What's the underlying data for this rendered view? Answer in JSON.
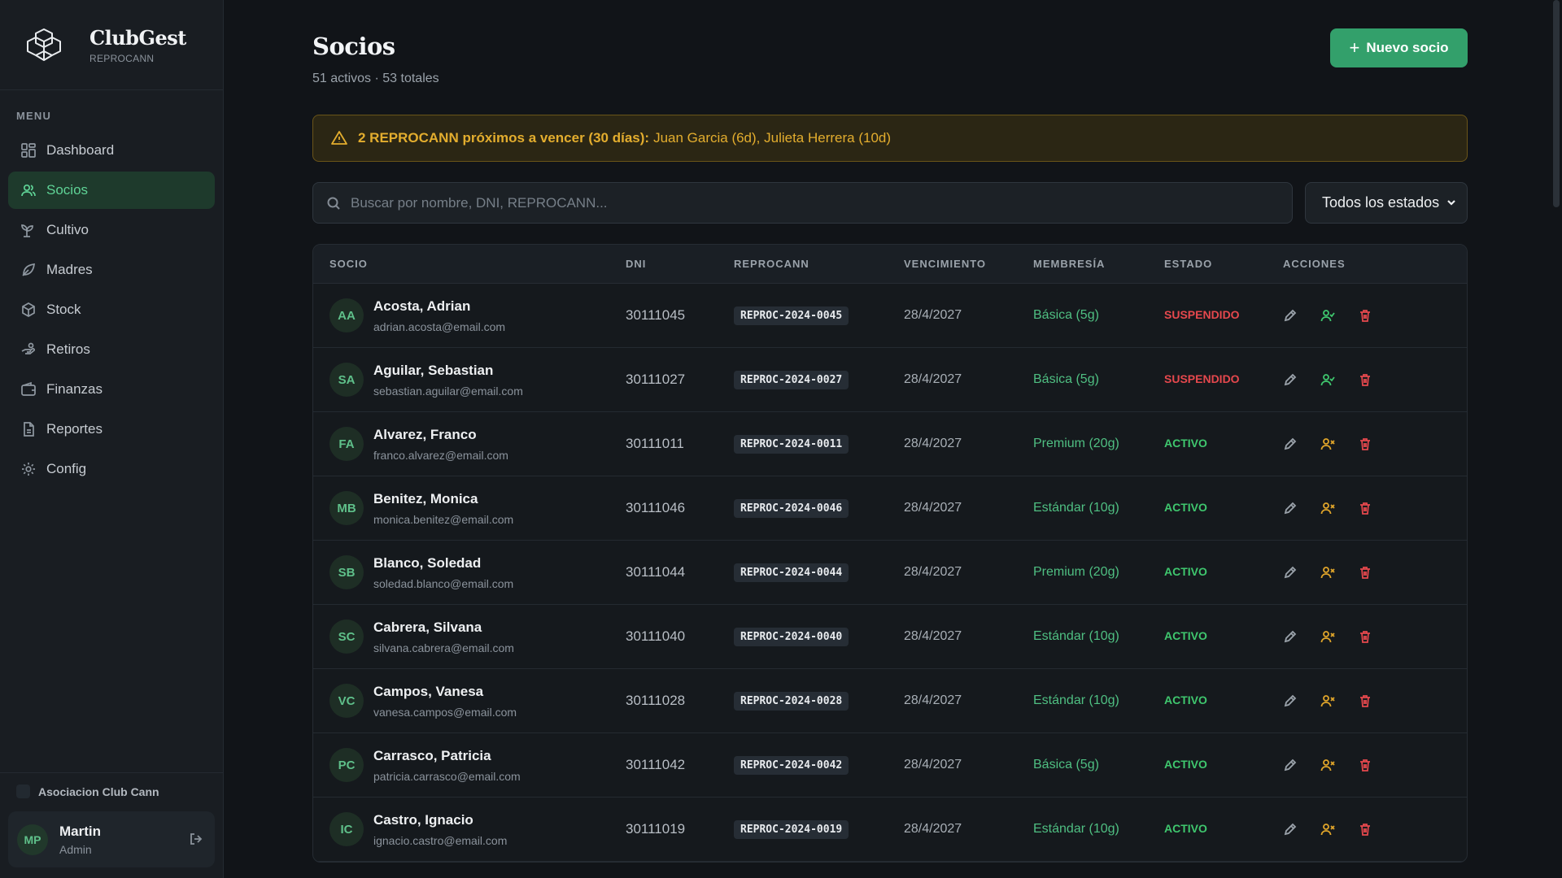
{
  "brand": {
    "name": "ClubGest",
    "sub": "REPROCANN"
  },
  "sidebar": {
    "menu_label": "MENU",
    "items": [
      {
        "label": "Dashboard",
        "icon": "grid-icon"
      },
      {
        "label": "Socios",
        "icon": "users-icon"
      },
      {
        "label": "Cultivo",
        "icon": "sprout-icon"
      },
      {
        "label": "Madres",
        "icon": "leaf-icon"
      },
      {
        "label": "Stock",
        "icon": "box-icon"
      },
      {
        "label": "Retiros",
        "icon": "hand-icon"
      },
      {
        "label": "Finanzas",
        "icon": "wallet-icon"
      },
      {
        "label": "Reportes",
        "icon": "file-icon"
      },
      {
        "label": "Config",
        "icon": "gear-icon"
      }
    ],
    "active": "Socios",
    "org": "Asociacion Club Cann",
    "user": {
      "initials": "MP",
      "name": "Martin",
      "role": "Admin"
    }
  },
  "header": {
    "title": "Socios",
    "subtitle": "51 activos · 53 totales",
    "new_button": "Nuevo socio"
  },
  "alert": {
    "bold": "2 REPROCANN próximos a vencer (30 días):",
    "text": "Juan Garcia (6d), Julieta Herrera (10d)"
  },
  "search": {
    "placeholder": "Buscar por nombre, DNI, REPROCANN..."
  },
  "filter": {
    "selected": "Todos los estados"
  },
  "table": {
    "columns": [
      "SOCIO",
      "DNI",
      "REPROCANN",
      "VENCIMIENTO",
      "MEMBRESÍA",
      "ESTADO",
      "ACCIONES"
    ],
    "rows": [
      {
        "initials": "AA",
        "name": "Acosta, Adrian",
        "email": "adrian.acosta@email.com",
        "dni": "30111045",
        "reprocann": "REPROC-2024-0045",
        "venc": "28/4/2027",
        "memb": "Básica (5g)",
        "estado": "SUSPENDIDO",
        "status": "susp"
      },
      {
        "initials": "SA",
        "name": "Aguilar, Sebastian",
        "email": "sebastian.aguilar@email.com",
        "dni": "30111027",
        "reprocann": "REPROC-2024-0027",
        "venc": "28/4/2027",
        "memb": "Básica (5g)",
        "estado": "SUSPENDIDO",
        "status": "susp"
      },
      {
        "initials": "FA",
        "name": "Alvarez, Franco",
        "email": "franco.alvarez@email.com",
        "dni": "30111011",
        "reprocann": "REPROC-2024-0011",
        "venc": "28/4/2027",
        "memb": "Premium (20g)",
        "estado": "ACTIVO",
        "status": "act"
      },
      {
        "initials": "MB",
        "name": "Benitez, Monica",
        "email": "monica.benitez@email.com",
        "dni": "30111046",
        "reprocann": "REPROC-2024-0046",
        "venc": "28/4/2027",
        "memb": "Estándar (10g)",
        "estado": "ACTIVO",
        "status": "act"
      },
      {
        "initials": "SB",
        "name": "Blanco, Soledad",
        "email": "soledad.blanco@email.com",
        "dni": "30111044",
        "reprocann": "REPROC-2024-0044",
        "venc": "28/4/2027",
        "memb": "Premium (20g)",
        "estado": "ACTIVO",
        "status": "act"
      },
      {
        "initials": "SC",
        "name": "Cabrera, Silvana",
        "email": "silvana.cabrera@email.com",
        "dni": "30111040",
        "reprocann": "REPROC-2024-0040",
        "venc": "28/4/2027",
        "memb": "Estándar (10g)",
        "estado": "ACTIVO",
        "status": "act"
      },
      {
        "initials": "VC",
        "name": "Campos, Vanesa",
        "email": "vanesa.campos@email.com",
        "dni": "30111028",
        "reprocann": "REPROC-2024-0028",
        "venc": "28/4/2027",
        "memb": "Estándar (10g)",
        "estado": "ACTIVO",
        "status": "act"
      },
      {
        "initials": "PC",
        "name": "Carrasco, Patricia",
        "email": "patricia.carrasco@email.com",
        "dni": "30111042",
        "reprocann": "REPROC-2024-0042",
        "venc": "28/4/2027",
        "memb": "Básica (5g)",
        "estado": "ACTIVO",
        "status": "act"
      },
      {
        "initials": "IC",
        "name": "Castro, Ignacio",
        "email": "ignacio.castro@email.com",
        "dni": "30111019",
        "reprocann": "REPROC-2024-0019",
        "venc": "28/4/2027",
        "memb": "Estándar (10g)",
        "estado": "ACTIVO",
        "status": "act"
      }
    ]
  },
  "colors": {
    "accent": "#33a06b",
    "active": "#3fc76e",
    "suspended": "#e5484d",
    "warning": "#e3ad2e"
  }
}
